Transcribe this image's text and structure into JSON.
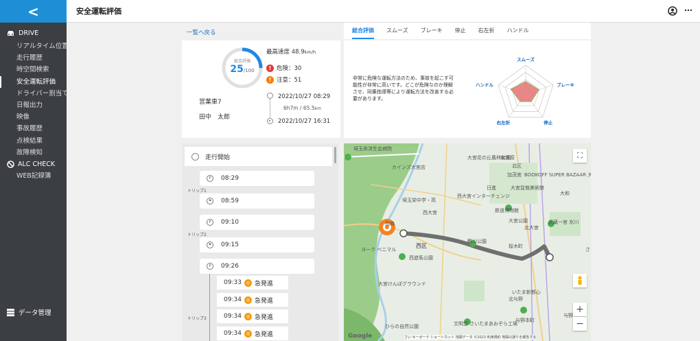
{
  "sidebar": {
    "logo": "<",
    "section_drive": "DRIVE",
    "items": [
      {
        "label": "リアルタイム位置"
      },
      {
        "label": "走行履歴"
      },
      {
        "label": "時空間検索"
      },
      {
        "label": "安全運転評価",
        "active": true
      },
      {
        "label": "ドライバー割当て"
      },
      {
        "label": "日報出力"
      },
      {
        "label": "映像"
      },
      {
        "label": "事故履歴"
      },
      {
        "label": "点検結果"
      },
      {
        "label": "故障検知"
      }
    ],
    "section_alc": "ALC CHECK",
    "alc_items": [
      {
        "label": "WEB記録簿"
      }
    ],
    "bottom_label": "データ管理"
  },
  "header": {
    "title": "安全運転評価",
    "more": "⋯",
    "user_icon": "user-circle-icon"
  },
  "back_link": "一覧へ戻る",
  "summary": {
    "score_label": "総合評価",
    "score": "25",
    "score_max": "/100",
    "score_fraction": 0.25,
    "max_speed_label": "最高速度",
    "max_speed_value": "48.9",
    "max_speed_unit": "km/h",
    "danger_icon": "!",
    "caution_icon": "!",
    "danger": "危険：30",
    "caution": "注意：51",
    "vehicle": "営業車7",
    "driver": "田中　太郎",
    "start_time": "2022/10/27 08:29",
    "duration_h": "6h7m",
    "duration_d": " / 65.5",
    "duration_unit": "km",
    "end_time": "2022/10/27 16:31",
    "colors": {
      "score": "#1e88e5",
      "danger": "#e53935",
      "caution": "#f57c00"
    }
  },
  "tabs": [
    {
      "label": "総合評価",
      "active": true
    },
    {
      "label": "スムーズ"
    },
    {
      "label": "ブレーキ"
    },
    {
      "label": "停止"
    },
    {
      "label": "右左折"
    },
    {
      "label": "ハンドル"
    }
  ],
  "radar": {
    "description": "非常に危険な運転方法のため、事故を起こす可能性が非常に高いです。どこが危険なのか理解させ、同乗指導等により運転方法を改善する必要があります。",
    "axes": [
      "スムーズ",
      "ブレーキ",
      "停止",
      "右左折",
      "ハンドル"
    ],
    "values": [
      0.2,
      0.22,
      0.15,
      0.15,
      0.25
    ],
    "colors": {
      "fill": "#e57373",
      "axis_label": "#1565c0"
    }
  },
  "events": {
    "start_label": "走行開始",
    "trips": [
      {
        "label": "トリップ1",
        "start": "08:29",
        "end": "08:59"
      },
      {
        "label": "トリップ2",
        "start": "09:10",
        "end": "09:15"
      },
      {
        "label": "トリップ3",
        "start": "09:26",
        "items": [
          {
            "time": "09:33",
            "type": "急発進"
          },
          {
            "time": "09:34",
            "type": "急発進"
          },
          {
            "time": "09:34",
            "type": "急発進"
          },
          {
            "time": "09:34",
            "type": "急発進"
          }
        ]
      }
    ]
  },
  "map": {
    "labels": [
      "埼玉県済生会病院",
      "カインズ大宮店",
      "大宮花の丘農林公園",
      "東宮原",
      "北区",
      "BOOKOFF SUPER BAZAAR 大宮ステラ",
      "日進",
      "大宮盆栽美術館",
      "加茂宮",
      "埼玉栄中学・高",
      "西大宮",
      "鉄道博物館",
      "大宮公園",
      "北大宮",
      "大和",
      "桜木町",
      "西区",
      "西遊馬公園",
      "鴨川公園",
      "大宮けんぽグラウンド",
      "いたま新都心",
      "北与野",
      "与野本町",
      "与野",
      "文明堂 さいたまあおぞら工場",
      "ひらの自然公園",
      "武蔵一宮 氷川",
      "さ",
      "西大宮インターチェンジ",
      "ヨーク ベニマル",
      "指扇"
    ],
    "google": "Google",
    "attribution": "さい キーボード ショートカット 地図データ ©2023 利用規約 地図の誤りを報告する",
    "zoom_in": "+",
    "zoom_out": "−",
    "fullscreen": "⛶"
  }
}
